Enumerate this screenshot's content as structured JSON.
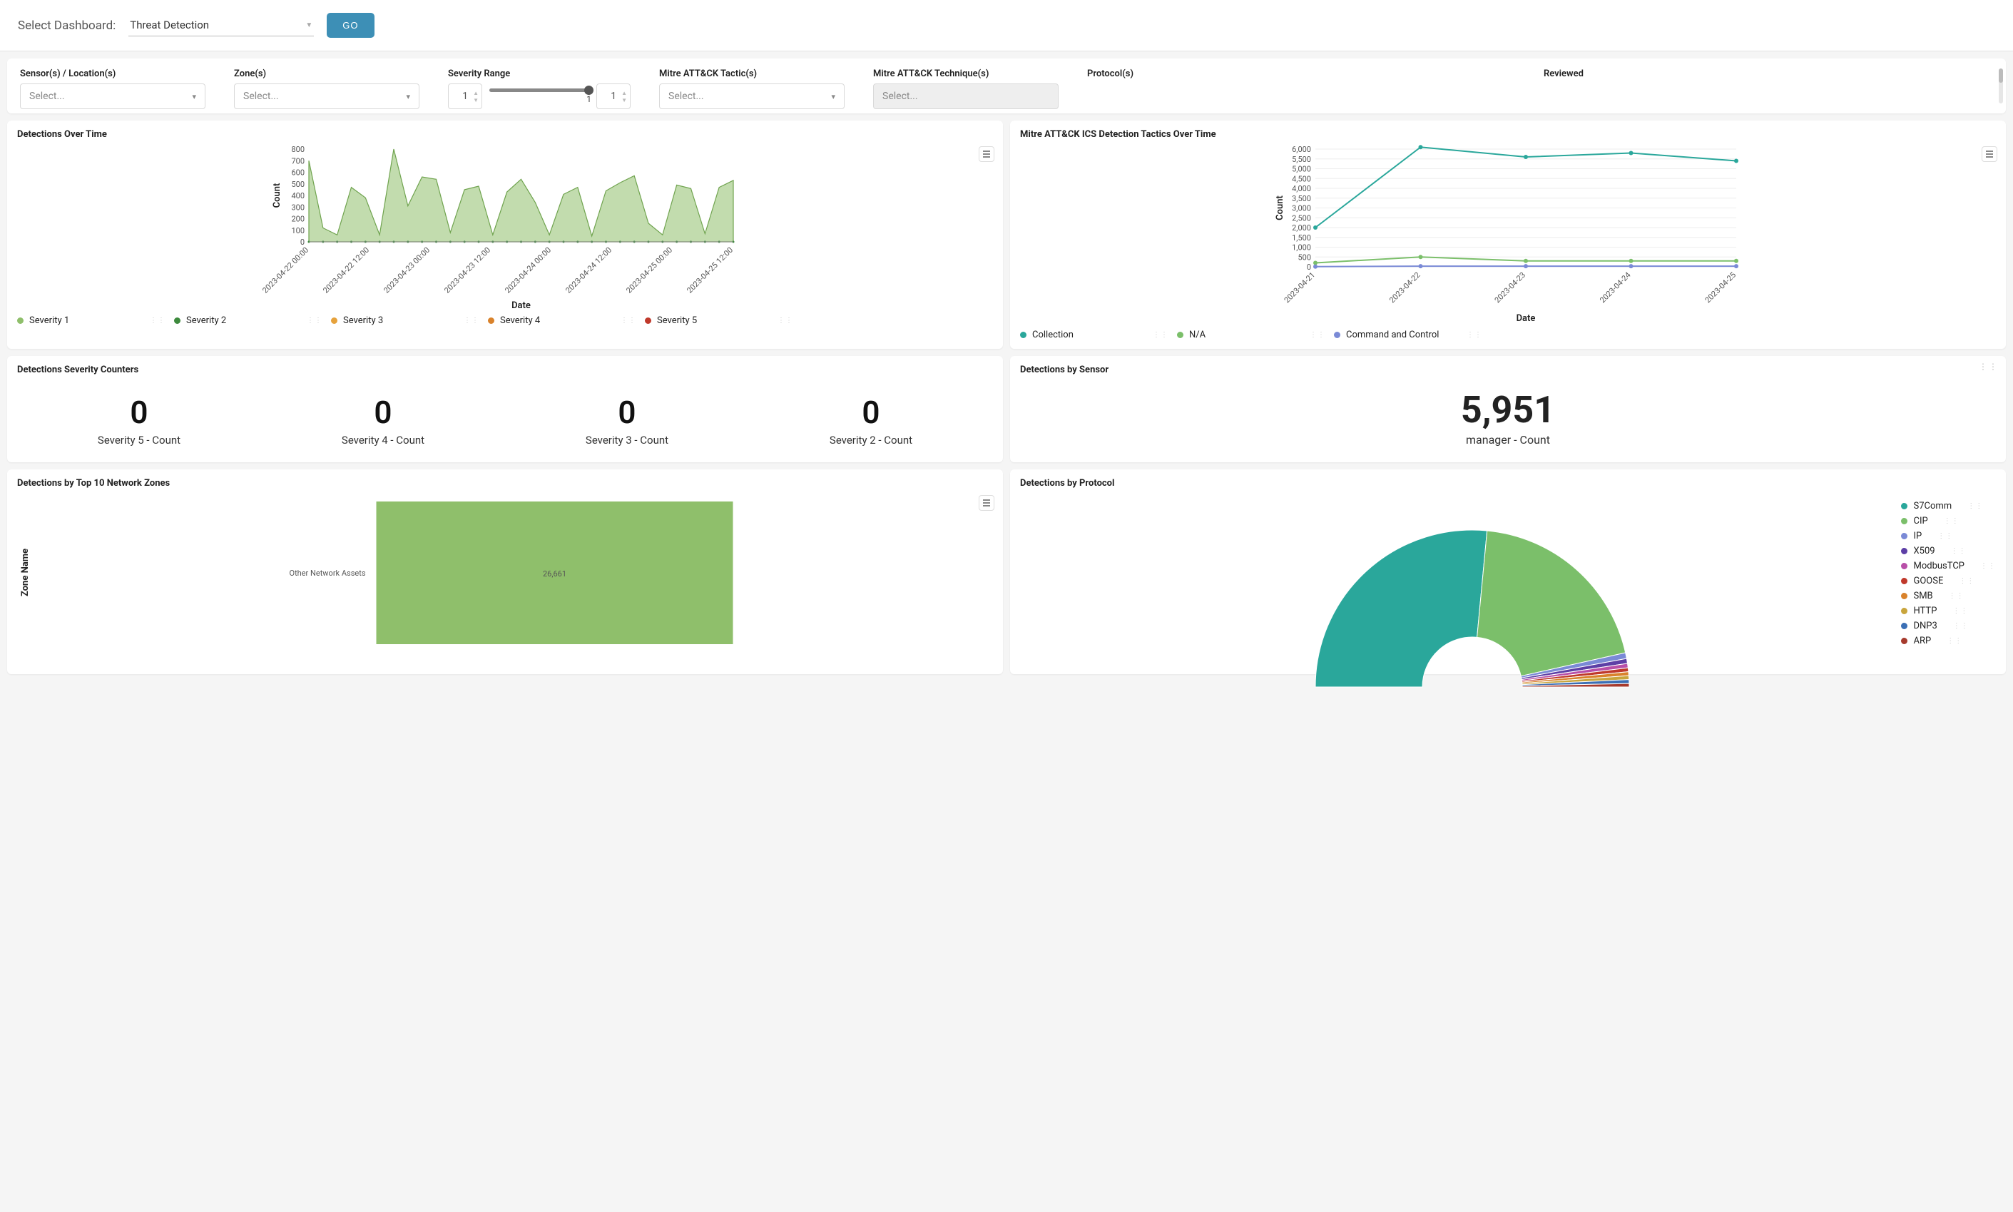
{
  "header": {
    "select_label": "Select Dashboard:",
    "dashboard_name": "Threat Detection",
    "go_label": "GO"
  },
  "filters": {
    "sensor": {
      "label": "Sensor(s) / Location(s)",
      "placeholder": "Select..."
    },
    "zone": {
      "label": "Zone(s)",
      "placeholder": "Select..."
    },
    "severity": {
      "label": "Severity Range",
      "low": "1",
      "high": "1",
      "slider_display": "1"
    },
    "tactic": {
      "label": "Mitre ATT&CK Tactic(s)",
      "placeholder": "Select..."
    },
    "technique": {
      "label": "Mitre ATT&CK Technique(s)",
      "placeholder": "Select..."
    },
    "protocol": {
      "label": "Protocol(s)"
    },
    "reviewed": {
      "label": "Reviewed"
    }
  },
  "panel1": {
    "title": "Detections Over Time",
    "ylabel": "Count",
    "xlabel": "Date",
    "legend": [
      {
        "name": "Severity 1",
        "color": "#8fbf6b"
      },
      {
        "name": "Severity 2",
        "color": "#3d8a3d"
      },
      {
        "name": "Severity 3",
        "color": "#e6a23c"
      },
      {
        "name": "Severity 4",
        "color": "#d9822b"
      },
      {
        "name": "Severity 5",
        "color": "#c0392b"
      }
    ]
  },
  "panel2": {
    "title": "Mitre ATT&CK ICS Detection Tactics Over Time",
    "ylabel": "Count",
    "xlabel": "Date",
    "legend": [
      {
        "name": "Collection",
        "color": "#2aa79b"
      },
      {
        "name": "N/A",
        "color": "#7bbf6a"
      },
      {
        "name": "Command and Control",
        "color": "#7a8ad6"
      }
    ]
  },
  "panel3": {
    "title": "Detections Severity Counters",
    "items": [
      {
        "val": "0",
        "label": "Severity 5 - Count"
      },
      {
        "val": "0",
        "label": "Severity 4 - Count"
      },
      {
        "val": "0",
        "label": "Severity 3 - Count"
      },
      {
        "val": "0",
        "label": "Severity 2 - Count"
      }
    ]
  },
  "panel4": {
    "title": "Detections by Sensor",
    "value": "5,951",
    "label": "manager - Count"
  },
  "panel5": {
    "title": "Detections by Top 10 Network Zones",
    "ylabel": "Zone Name",
    "row_label": "Other Network Assets",
    "row_value": "26,661"
  },
  "panel6": {
    "title": "Detections by Protocol",
    "legend": [
      {
        "name": "S7Comm",
        "color": "#2aa79b"
      },
      {
        "name": "CIP",
        "color": "#7bbf6a"
      },
      {
        "name": "IP",
        "color": "#7a8ad6"
      },
      {
        "name": "X509",
        "color": "#5d3fa6"
      },
      {
        "name": "ModbusTCP",
        "color": "#b84fa8"
      },
      {
        "name": "GOOSE",
        "color": "#c0392b"
      },
      {
        "name": "SMB",
        "color": "#d9822b"
      },
      {
        "name": "HTTP",
        "color": "#c9a53c"
      },
      {
        "name": "DNP3",
        "color": "#3b6fb5"
      },
      {
        "name": "ARP",
        "color": "#a63a2d"
      }
    ]
  },
  "chart_data": [
    {
      "type": "area",
      "title": "Detections Over Time",
      "xlabel": "Date",
      "ylabel": "Count",
      "ylim": [
        0,
        800
      ],
      "y_ticks": [
        0,
        100,
        200,
        300,
        400,
        500,
        600,
        700,
        800
      ],
      "x_ticks": [
        "2023-04-22 00:00",
        "2023-04-22 12:00",
        "2023-04-23 00:00",
        "2023-04-23 12:00",
        "2023-04-24 00:00",
        "2023-04-24 12:00",
        "2023-04-25 00:00",
        "2023-04-25 12:00"
      ],
      "note": "Series Severity 1 dominant; Severity 2-5 near zero across range (approximate, read from pixels)",
      "series": [
        {
          "name": "Severity 1",
          "values_approx_peaks": [
            700,
            120,
            60,
            470,
            380,
            60,
            800,
            310,
            560,
            540,
            80,
            450,
            480,
            60,
            430,
            540,
            340,
            60,
            410,
            470,
            50,
            440,
            510,
            570,
            160,
            60,
            490,
            460,
            70,
            470,
            530
          ]
        },
        {
          "name": "Severity 2",
          "constant_approx": 0
        },
        {
          "name": "Severity 3",
          "constant_approx": 0
        },
        {
          "name": "Severity 4",
          "constant_approx": 0
        },
        {
          "name": "Severity 5",
          "constant_approx": 0
        }
      ]
    },
    {
      "type": "line",
      "title": "Mitre ATT&CK ICS Detection Tactics Over Time",
      "xlabel": "Date",
      "ylabel": "Count",
      "ylim": [
        0,
        6000
      ],
      "y_ticks": [
        0,
        500,
        1000,
        1500,
        2000,
        2500,
        3000,
        3500,
        4000,
        4500,
        5000,
        5500,
        6000
      ],
      "x_ticks": [
        "2023-04-21",
        "2023-04-22",
        "2023-04-23",
        "2023-04-24",
        "2023-04-25"
      ],
      "series": [
        {
          "name": "Collection",
          "values": [
            2000,
            6100,
            5600,
            5800,
            5400
          ]
        },
        {
          "name": "N/A",
          "values": [
            200,
            500,
            300,
            300,
            300
          ]
        },
        {
          "name": "Command and Control",
          "values": [
            10,
            30,
            30,
            30,
            30
          ]
        }
      ]
    },
    {
      "type": "bar",
      "orientation": "horizontal",
      "title": "Detections by Top 10 Network Zones",
      "ylabel": "Zone Name",
      "categories": [
        "Other Network Assets"
      ],
      "values": [
        26661
      ]
    },
    {
      "type": "pie",
      "title": "Detections by Protocol",
      "note": "Donut chart. S7Comm and CIP together dominate; remaining protocols are thin slices. Exact values not labeled.",
      "slices": [
        {
          "name": "S7Comm",
          "share_approx": 0.53
        },
        {
          "name": "CIP",
          "share_approx": 0.4
        },
        {
          "name": "IP",
          "share_approx": 0.012
        },
        {
          "name": "X509",
          "share_approx": 0.01
        },
        {
          "name": "ModbusTCP",
          "share_approx": 0.009
        },
        {
          "name": "GOOSE",
          "share_approx": 0.008
        },
        {
          "name": "SMB",
          "share_approx": 0.008
        },
        {
          "name": "HTTP",
          "share_approx": 0.008
        },
        {
          "name": "DNP3",
          "share_approx": 0.008
        },
        {
          "name": "ARP",
          "share_approx": 0.007
        }
      ]
    }
  ]
}
